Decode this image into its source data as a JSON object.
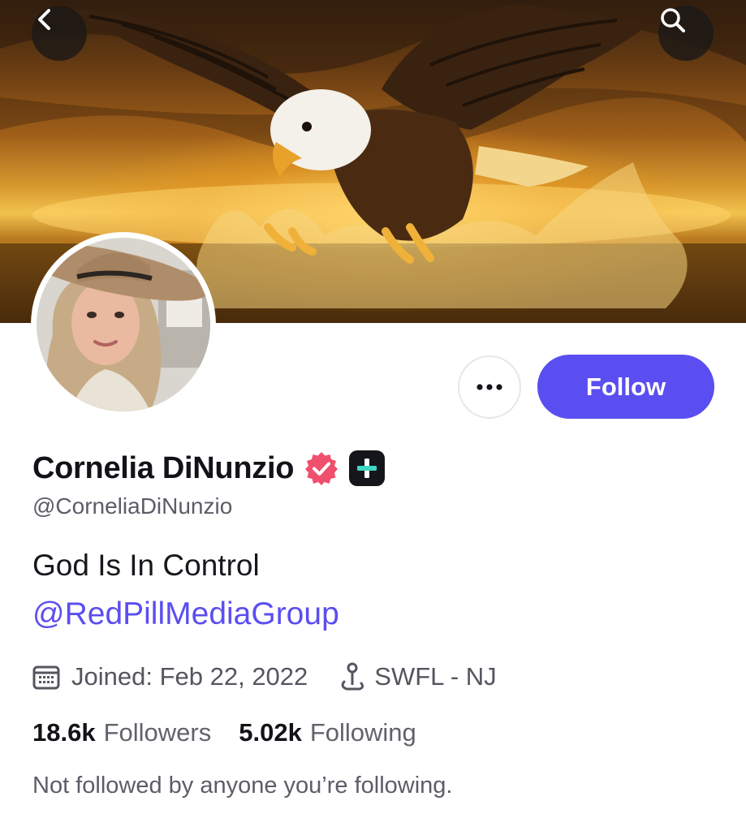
{
  "profile": {
    "display_name": "Cornelia DiNunzio",
    "handle": "@CorneliaDiNunzio",
    "bio": "God Is In Control",
    "bio_link": "@RedPillMediaGroup",
    "joined": "Joined: Feb 22, 2022",
    "location": "SWFL - NJ",
    "followers_count": "18.6k",
    "followers_label": "Followers",
    "following_count": "5.02k",
    "following_label": "Following",
    "mutual_text": "Not followed by anyone you’re following."
  },
  "actions": {
    "follow_label": "Follow"
  },
  "icons": {
    "back": "chevron-left-icon",
    "search": "search-icon",
    "more": "more-horizontal-icon",
    "verified": "verified-badge-icon",
    "plus": "plus-badge-icon",
    "calendar": "calendar-icon",
    "location": "location-pin-icon"
  },
  "colors": {
    "accent": "#5b4ef0",
    "verified": "#f0506e",
    "plus_badge": "#15151c",
    "plus_cross": "#3fd6c4"
  }
}
